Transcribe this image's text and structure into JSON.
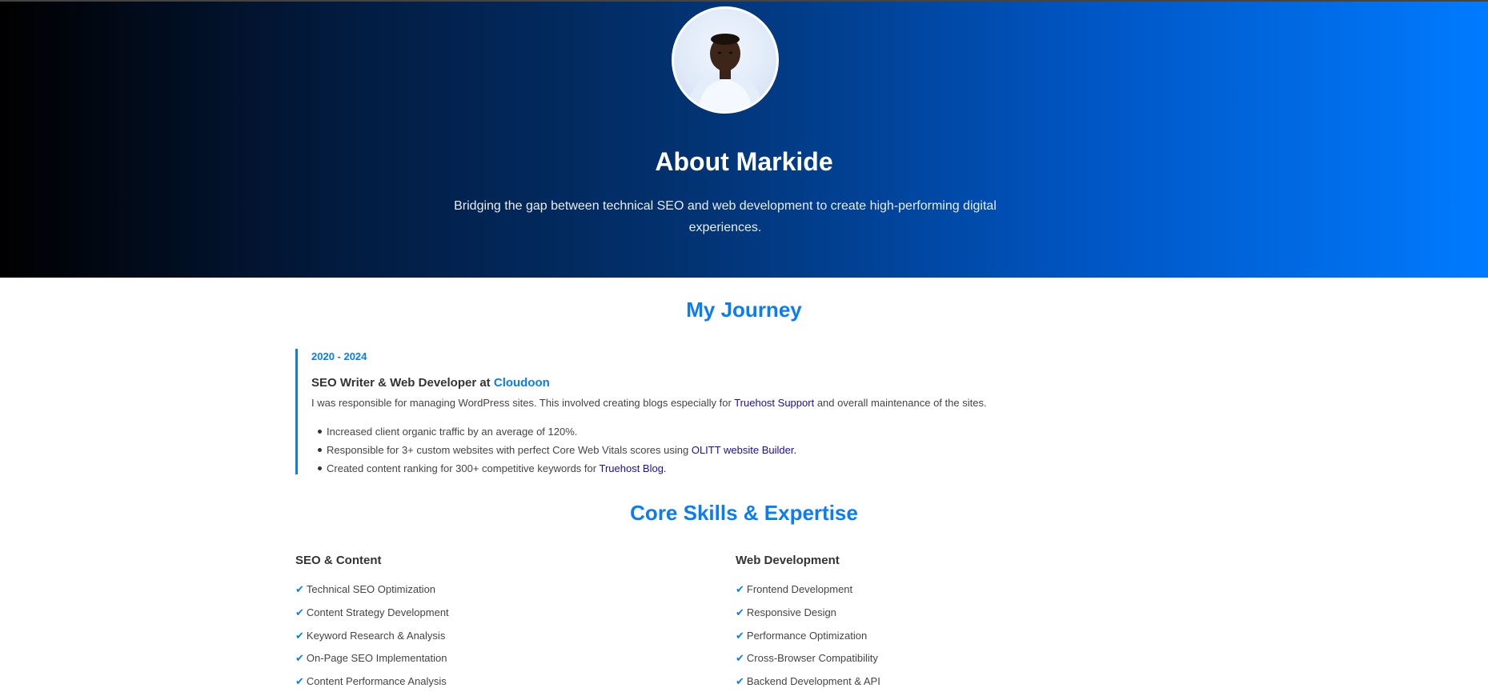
{
  "hero": {
    "title": "About Markide",
    "subtitle": "Bridging the gap between technical SEO and web development to create high-performing digital experiences."
  },
  "journey": {
    "title": "My Journey",
    "entries": [
      {
        "date": "2020 - 2024",
        "role": "SEO Writer & Web Developer at",
        "company": "Cloudoon",
        "desc_before": "I was responsible for managing WordPress sites. This involved creating blogs especially for",
        "desc_link": "Truehost Support",
        "desc_after": "and overall maintenance of the sites.",
        "bullets": [
          {
            "text": "Increased client organic traffic by an average of 120%."
          },
          {
            "text": "Responsible for 3+ custom websites with perfect Core Web Vitals scores using",
            "link": "OLITT website Builder."
          },
          {
            "text": "Created content ranking for 300+ competitive keywords for",
            "link": "Truehost Blog."
          }
        ]
      }
    ]
  },
  "skills": {
    "title": "Core Skills & Expertise",
    "check_icon": "✔",
    "columns": [
      {
        "heading": "SEO & Content",
        "items": [
          "Technical SEO Optimization",
          "Content Strategy Development",
          "Keyword Research & Analysis",
          "On-Page SEO Implementation",
          "Content Performance Analysis"
        ]
      },
      {
        "heading": "Web Development",
        "items": [
          "Frontend Development",
          "Responsive Design",
          "Performance Optimization",
          "Cross-Browser Compatibility",
          "Backend Development & API"
        ]
      }
    ]
  },
  "colors": {
    "accent": "#0a7cf6",
    "link": "#1a0dab",
    "hero_start": "#000000",
    "hero_end": "#007bff"
  }
}
